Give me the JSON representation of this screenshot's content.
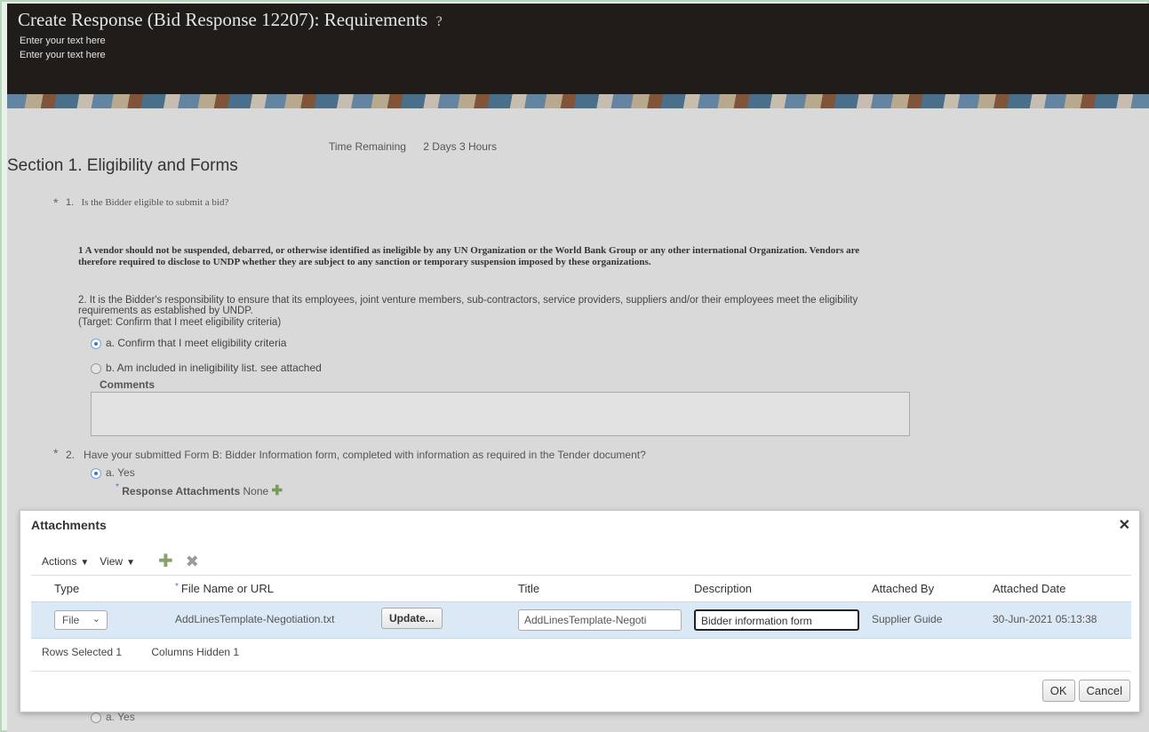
{
  "header": {
    "title": "Create Response (Bid Response 12207): Requirements",
    "help_icon": "?",
    "subtitle_1": "Enter your text here",
    "subtitle_2": "Enter your text here"
  },
  "time": {
    "label": "Time Remaining",
    "value": "2 Days 3 Hours"
  },
  "section": {
    "title": "Section 1. Eligibility and Forms"
  },
  "q1": {
    "number": "1.",
    "text": "Is the Bidder eligible to submit a bid?",
    "para1": "1   A vendor should not be suspended, debarred, or otherwise identified as ineligible by any UN Organization or the World Bank Group or any other international Organization. Vendors are therefore required to disclose to UNDP whether they are subject to any sanction or temporary suspension imposed by these organizations.",
    "para2": "2.   It is the Bidder's responsibility to ensure that its employees, joint venture members, sub-contractors, service providers, suppliers and/or their employees meet the eligibility requirements as established by UNDP.",
    "target": "(Target: Confirm that I meet eligibility criteria)",
    "option_a": "a. Confirm that I meet eligibility criteria",
    "option_b": "b. Am included in ineligibility list. see attached",
    "comments_label": "Comments"
  },
  "q2": {
    "number": "2.",
    "text": "Have your submitted Form B: Bidder Information form, completed with information as required in the Tender document?",
    "option_a": "a. Yes",
    "attachments_label": "Response Attachments",
    "attachments_value": "None"
  },
  "behind_option": "a. Yes",
  "modal": {
    "title": "Attachments",
    "toolbar": {
      "actions": "Actions",
      "view": "View"
    },
    "columns": {
      "type": "Type",
      "file": "File Name or URL",
      "title": "Title",
      "description": "Description",
      "attached_by": "Attached By",
      "attached_date": "Attached Date"
    },
    "row": {
      "type": "File",
      "file_name": "AddLinesTemplate-Negotiation.txt",
      "update_button": "Update...",
      "title": "AddLinesTemplate-Negoti",
      "description": "Bidder information form",
      "attached_by": "Supplier Guide",
      "attached_date": "30-Jun-2021 05:13:38"
    },
    "status": {
      "rows_selected": "Rows Selected  1",
      "columns_hidden": "Columns Hidden  1"
    },
    "ok": "OK",
    "cancel": "Cancel"
  }
}
